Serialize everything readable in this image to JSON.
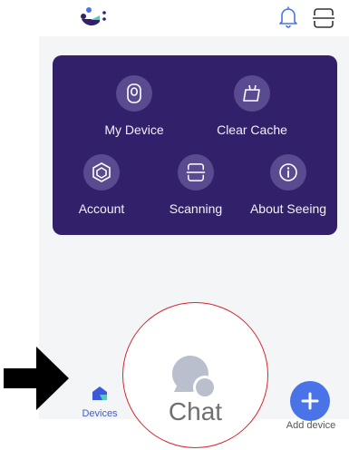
{
  "card": {
    "tiles": [
      {
        "label": "My Device",
        "icon": "device-icon"
      },
      {
        "label": "Clear Cache",
        "icon": "broom-icon"
      },
      {
        "label": "Account",
        "icon": "hexagon-icon"
      },
      {
        "label": "Scanning",
        "icon": "scan-icon"
      },
      {
        "label": "About Seeing",
        "icon": "info-icon"
      }
    ]
  },
  "bottom": {
    "devices_label": "Devices",
    "chat_label": "Chat",
    "add_label": "Add device"
  },
  "colors": {
    "card_bg": "#33206a",
    "accent_blue": "#4a73e8",
    "annotation_red": "#d9232e"
  }
}
